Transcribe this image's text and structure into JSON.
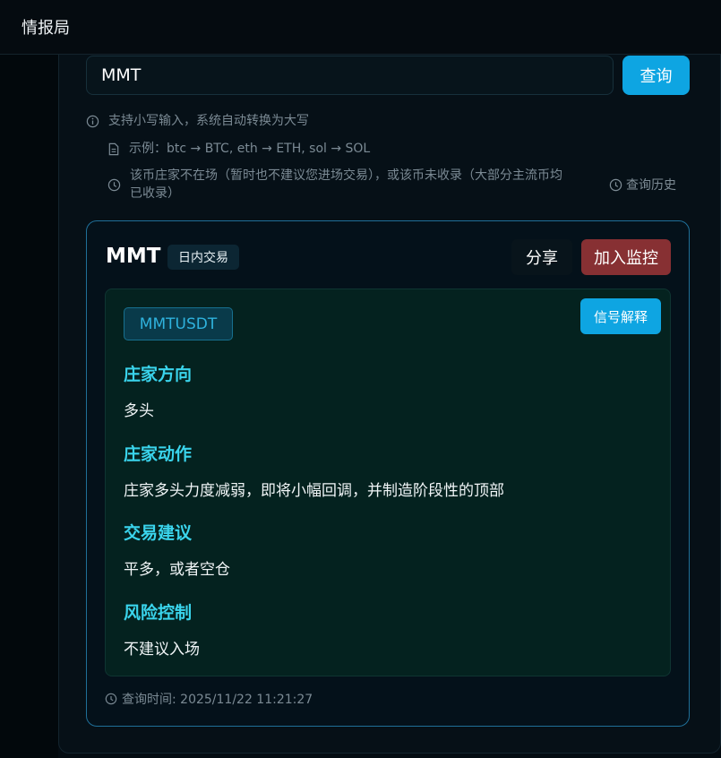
{
  "app": {
    "title": "情报局"
  },
  "search": {
    "value": "MMT",
    "button_label": "查询"
  },
  "hints": {
    "line1": "支持小写输入，系统自动转换为大写",
    "line2": "示例：btc → BTC, eth → ETH, sol → SOL",
    "line3_a": "该币庄家不在场（暂时也不建议您进场交易），或该币未收录（大部分主流币均",
    "line3_b": "已收录）",
    "history_label": "查询历史"
  },
  "result": {
    "symbol": "MMT",
    "mode_tag": "日内交易",
    "share_label": "分享",
    "monitor_label": "加入监控",
    "pair": "MMTUSDT",
    "signal_label": "信号解释",
    "sections": [
      {
        "title": "庄家方向",
        "value": "多头"
      },
      {
        "title": "庄家动作",
        "value": "庄家多头力度减弱，即将小幅回调，并制造阶段性的顶部"
      },
      {
        "title": "交易建议",
        "value": "平多，或者空仓"
      },
      {
        "title": "风险控制",
        "value": "不建议入场"
      }
    ],
    "query_time": "查询时间: 2025/11/22 11:21:27"
  },
  "colors": {
    "accent": "#0ea5e2",
    "danger": "#873033",
    "section_title": "#3ad4ec",
    "card_border": "#1f6f98"
  },
  "icons": {
    "info": "info-icon",
    "example": "document-icon",
    "notice": "clock-icon",
    "history": "clock-icon",
    "time": "clock-icon"
  }
}
